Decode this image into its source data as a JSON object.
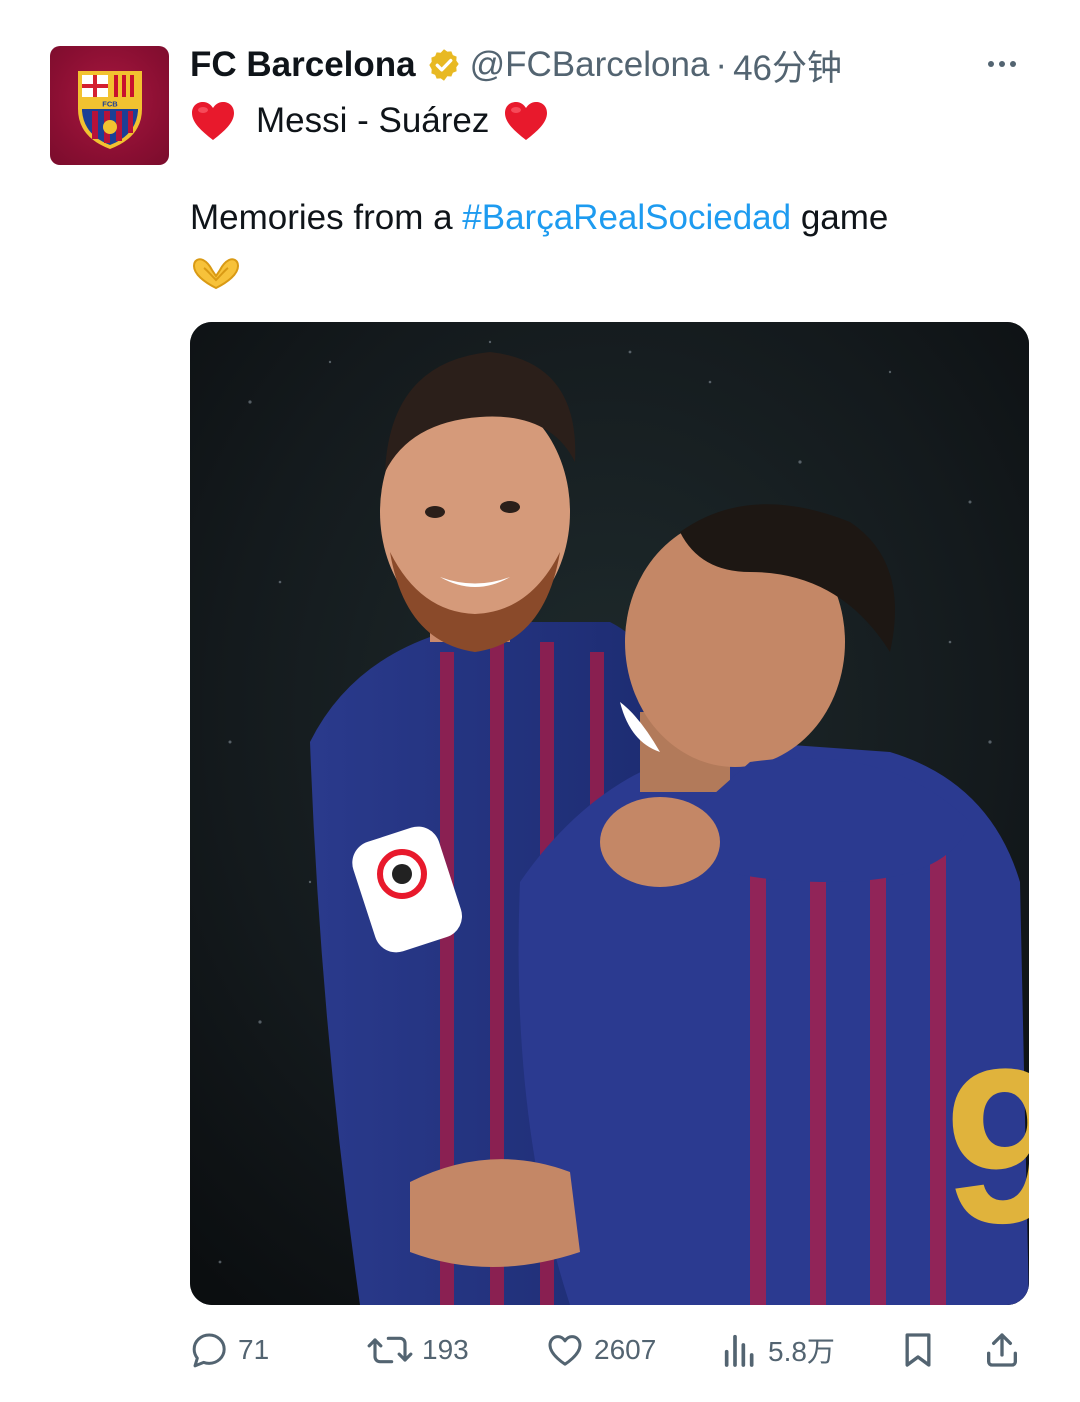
{
  "tweet": {
    "author_name": "FC Barcelona",
    "handle": "@FCBarcelona",
    "separator": "·",
    "time": "46分钟",
    "line1_text": "Messi - Suárez",
    "body_prefix": "Memories from a ",
    "hashtag": "#BarçaRealSociedad",
    "body_suffix": " game"
  },
  "avatar_logo_text": "FCB",
  "actions": {
    "replies": "71",
    "retweets": "193",
    "likes": "2607",
    "views": "5.8万"
  },
  "colors": {
    "link": "#1d9bf0",
    "secondary_text": "#536471",
    "verified_gold": "#e8b923",
    "avatar_bg": "#8c0f33"
  },
  "icons": [
    "more-options-icon",
    "verified-badge-icon",
    "red-heart-emoji",
    "heart-hands-emoji",
    "reply-icon",
    "retweet-icon",
    "like-icon",
    "views-icon",
    "bookmark-icon",
    "share-icon"
  ]
}
